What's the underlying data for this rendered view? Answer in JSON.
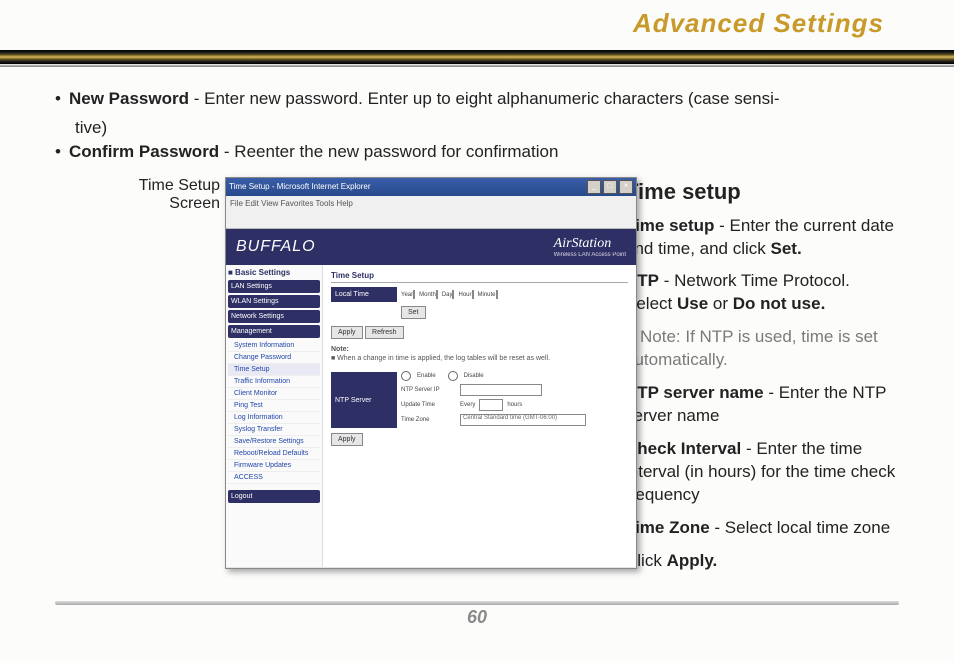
{
  "page": {
    "title": "Advanced Settings",
    "number": "60"
  },
  "bullets": {
    "new_password_label": "New Password",
    "new_password_text": " - Enter new password.  Enter up to eight alphanumeric characters (case sensi-",
    "new_password_wrap": "tive)",
    "confirm_password_label": "Confirm Password",
    "confirm_password_text": " - Reenter the new password for confirmation"
  },
  "caption": {
    "line1": "Time Setup",
    "line2": "Screen"
  },
  "screenshot": {
    "window_title": "Time Setup - Microsoft Internet Explorer",
    "menubar": "File   Edit   View   Favorites   Tools   Help",
    "brand": "BUFFALO",
    "product": "AirStation",
    "product_sub": "Wireless LAN Access Point",
    "side_heading": "■ Basic Settings",
    "side_main_items": [
      "LAN Settings",
      "WLAN Settings",
      "Network Settings",
      "Management"
    ],
    "side_sub_items": [
      "System Information",
      "Change Password",
      "Time Setup",
      "Traffic Information",
      "Client Monitor",
      "Ping Test",
      "Log Information",
      "Syslog Transfer",
      "Save/Restore Settings",
      "Reboot/Reload Defaults",
      "Firmware Updates",
      "ACCESS"
    ],
    "side_logout": "Logout",
    "section1": "Time Setup",
    "local_time_label": "Local Time",
    "year_lbl": "Year",
    "month_lbl": "Month",
    "day_lbl": "Day",
    "hour_lbl": "Hour",
    "minute_lbl": "Minute",
    "set_btn": "Set",
    "apply_btn": "Apply",
    "refresh_btn": "Refresh",
    "note_heading": "Note:",
    "note_body": "■  When a change in time is applied, the log tables will be reset as well.",
    "ntp_label": "NTP Server",
    "enable_lbl": "Enable",
    "disable_lbl": "Disable",
    "ntp_server_ip": "NTP Server IP",
    "update_time_lbl": "Update Time",
    "every_lbl": "Every",
    "hours_lbl": "hours",
    "time_zone_lbl": "Time Zone",
    "tz_value": "Central Standard time (GMT-06:00)"
  },
  "desc": {
    "heading": "Time setup",
    "p1_b": "Time setup",
    "p1_t": " - Enter the current date and time, and click ",
    "p1_b2": "Set.",
    "p2_b": "NTP",
    "p2_t": " - Network Time Protocol. Select ",
    "p2_b2": "Use",
    "p2_or": " or ",
    "p2_b3": "Do not use.",
    "note": "■ Note: If NTP is used, time is set automatically.",
    "p3_b": "NTP server name",
    "p3_t": " - Enter the NTP server name",
    "p4_b": "Check Interval",
    "p4_t": " - Enter the time interval (in hours) for the time check frequency",
    "p5_b": "Time Zone",
    "p5_t": " - Select local time zone",
    "p6_t": "Click ",
    "p6_b": "Apply."
  }
}
